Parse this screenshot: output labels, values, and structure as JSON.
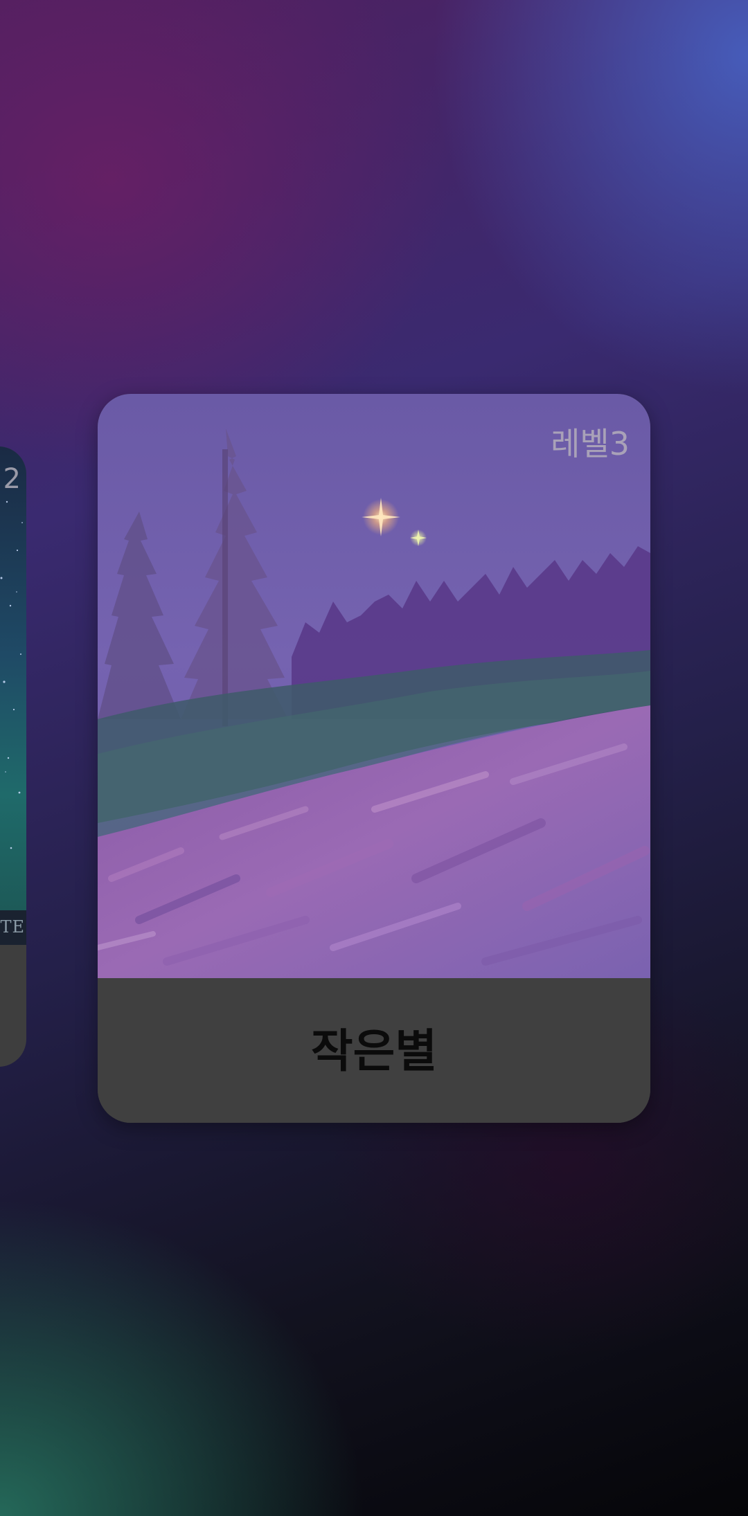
{
  "carousel": {
    "previous_card": {
      "level_label": "2",
      "strip_text": "TE"
    },
    "current_card": {
      "level_label": "레벨3",
      "title": "작은별"
    }
  }
}
